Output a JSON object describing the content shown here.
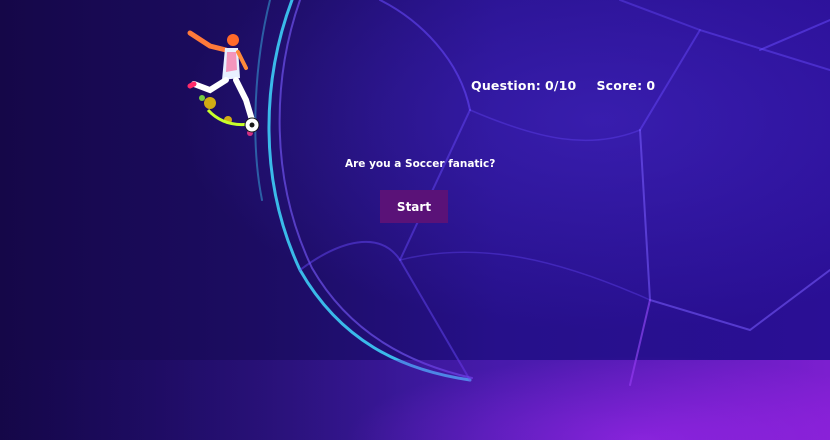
{
  "hud": {
    "question_label": "Question:",
    "question_value": "0/10",
    "score_label": "Score:",
    "score_value": "0"
  },
  "main": {
    "prompt": "Are you a Soccer fanatic?",
    "start_label": "Start"
  },
  "colors": {
    "background": "#1d0d66",
    "accent_glow": "#be28ff",
    "button": "#5a1278",
    "line_cyan": "#3fd8ff",
    "text": "#ffffff"
  },
  "icons": {
    "player": "soccer-player-icon"
  }
}
